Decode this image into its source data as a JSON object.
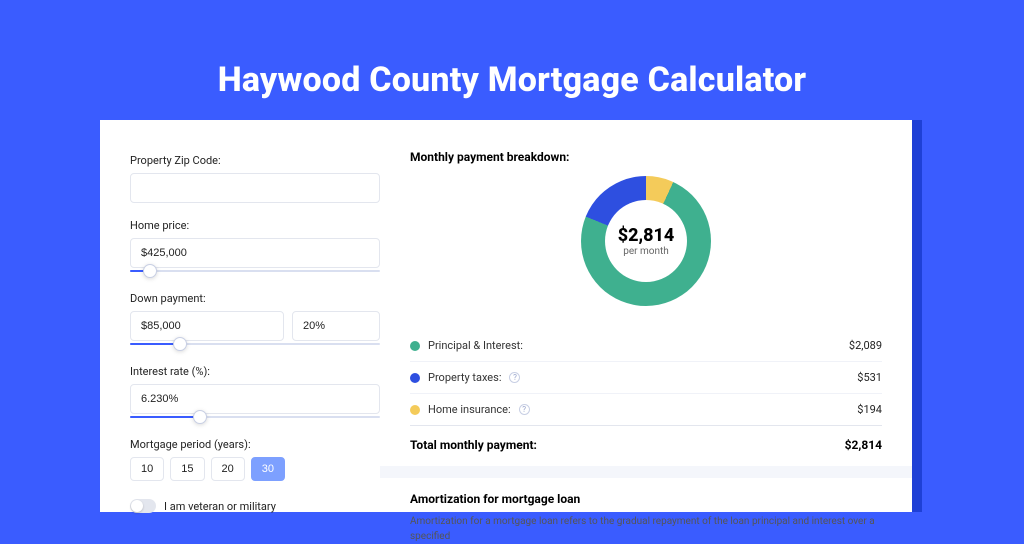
{
  "colors": {
    "principal": "#3fb08f",
    "taxes": "#2e4fe0",
    "insurance": "#f4cb5a"
  },
  "title": "Haywood County Mortgage Calculator",
  "form": {
    "zip_label": "Property Zip Code:",
    "zip_value": "",
    "home_price_label": "Home price:",
    "home_price_value": "$425,000",
    "home_price_slider_pct": 8,
    "down_payment_label": "Down payment:",
    "down_payment_value": "$85,000",
    "down_payment_pct_value": "20%",
    "down_payment_slider_pct": 20,
    "rate_label": "Interest rate (%):",
    "rate_value": "6.230%",
    "rate_slider_pct": 28,
    "period_label": "Mortgage period (years):",
    "periods": [
      "10",
      "15",
      "20",
      "30"
    ],
    "period_selected": "30",
    "veteran_label": "I am veteran or military"
  },
  "breakdown": {
    "title": "Monthly payment breakdown:",
    "center_amount": "$2,814",
    "center_sub": "per month",
    "items": [
      {
        "label": "Principal & Interest:",
        "value": "$2,089",
        "color_key": "principal",
        "info": false
      },
      {
        "label": "Property taxes:",
        "value": "$531",
        "color_key": "taxes",
        "info": true
      },
      {
        "label": "Home insurance:",
        "value": "$194",
        "color_key": "insurance",
        "info": true
      }
    ],
    "total_label": "Total monthly payment:",
    "total_value": "$2,814"
  },
  "chart_data": {
    "type": "pie",
    "title": "Monthly payment breakdown",
    "series": [
      {
        "name": "Principal & Interest",
        "value": 2089
      },
      {
        "name": "Property taxes",
        "value": 531
      },
      {
        "name": "Home insurance",
        "value": 194
      }
    ],
    "total": 2814,
    "unit": "USD/month"
  },
  "amort": {
    "title": "Amortization for mortgage loan",
    "text": "Amortization for a mortgage loan refers to the gradual repayment of the loan principal and interest over a specified"
  }
}
